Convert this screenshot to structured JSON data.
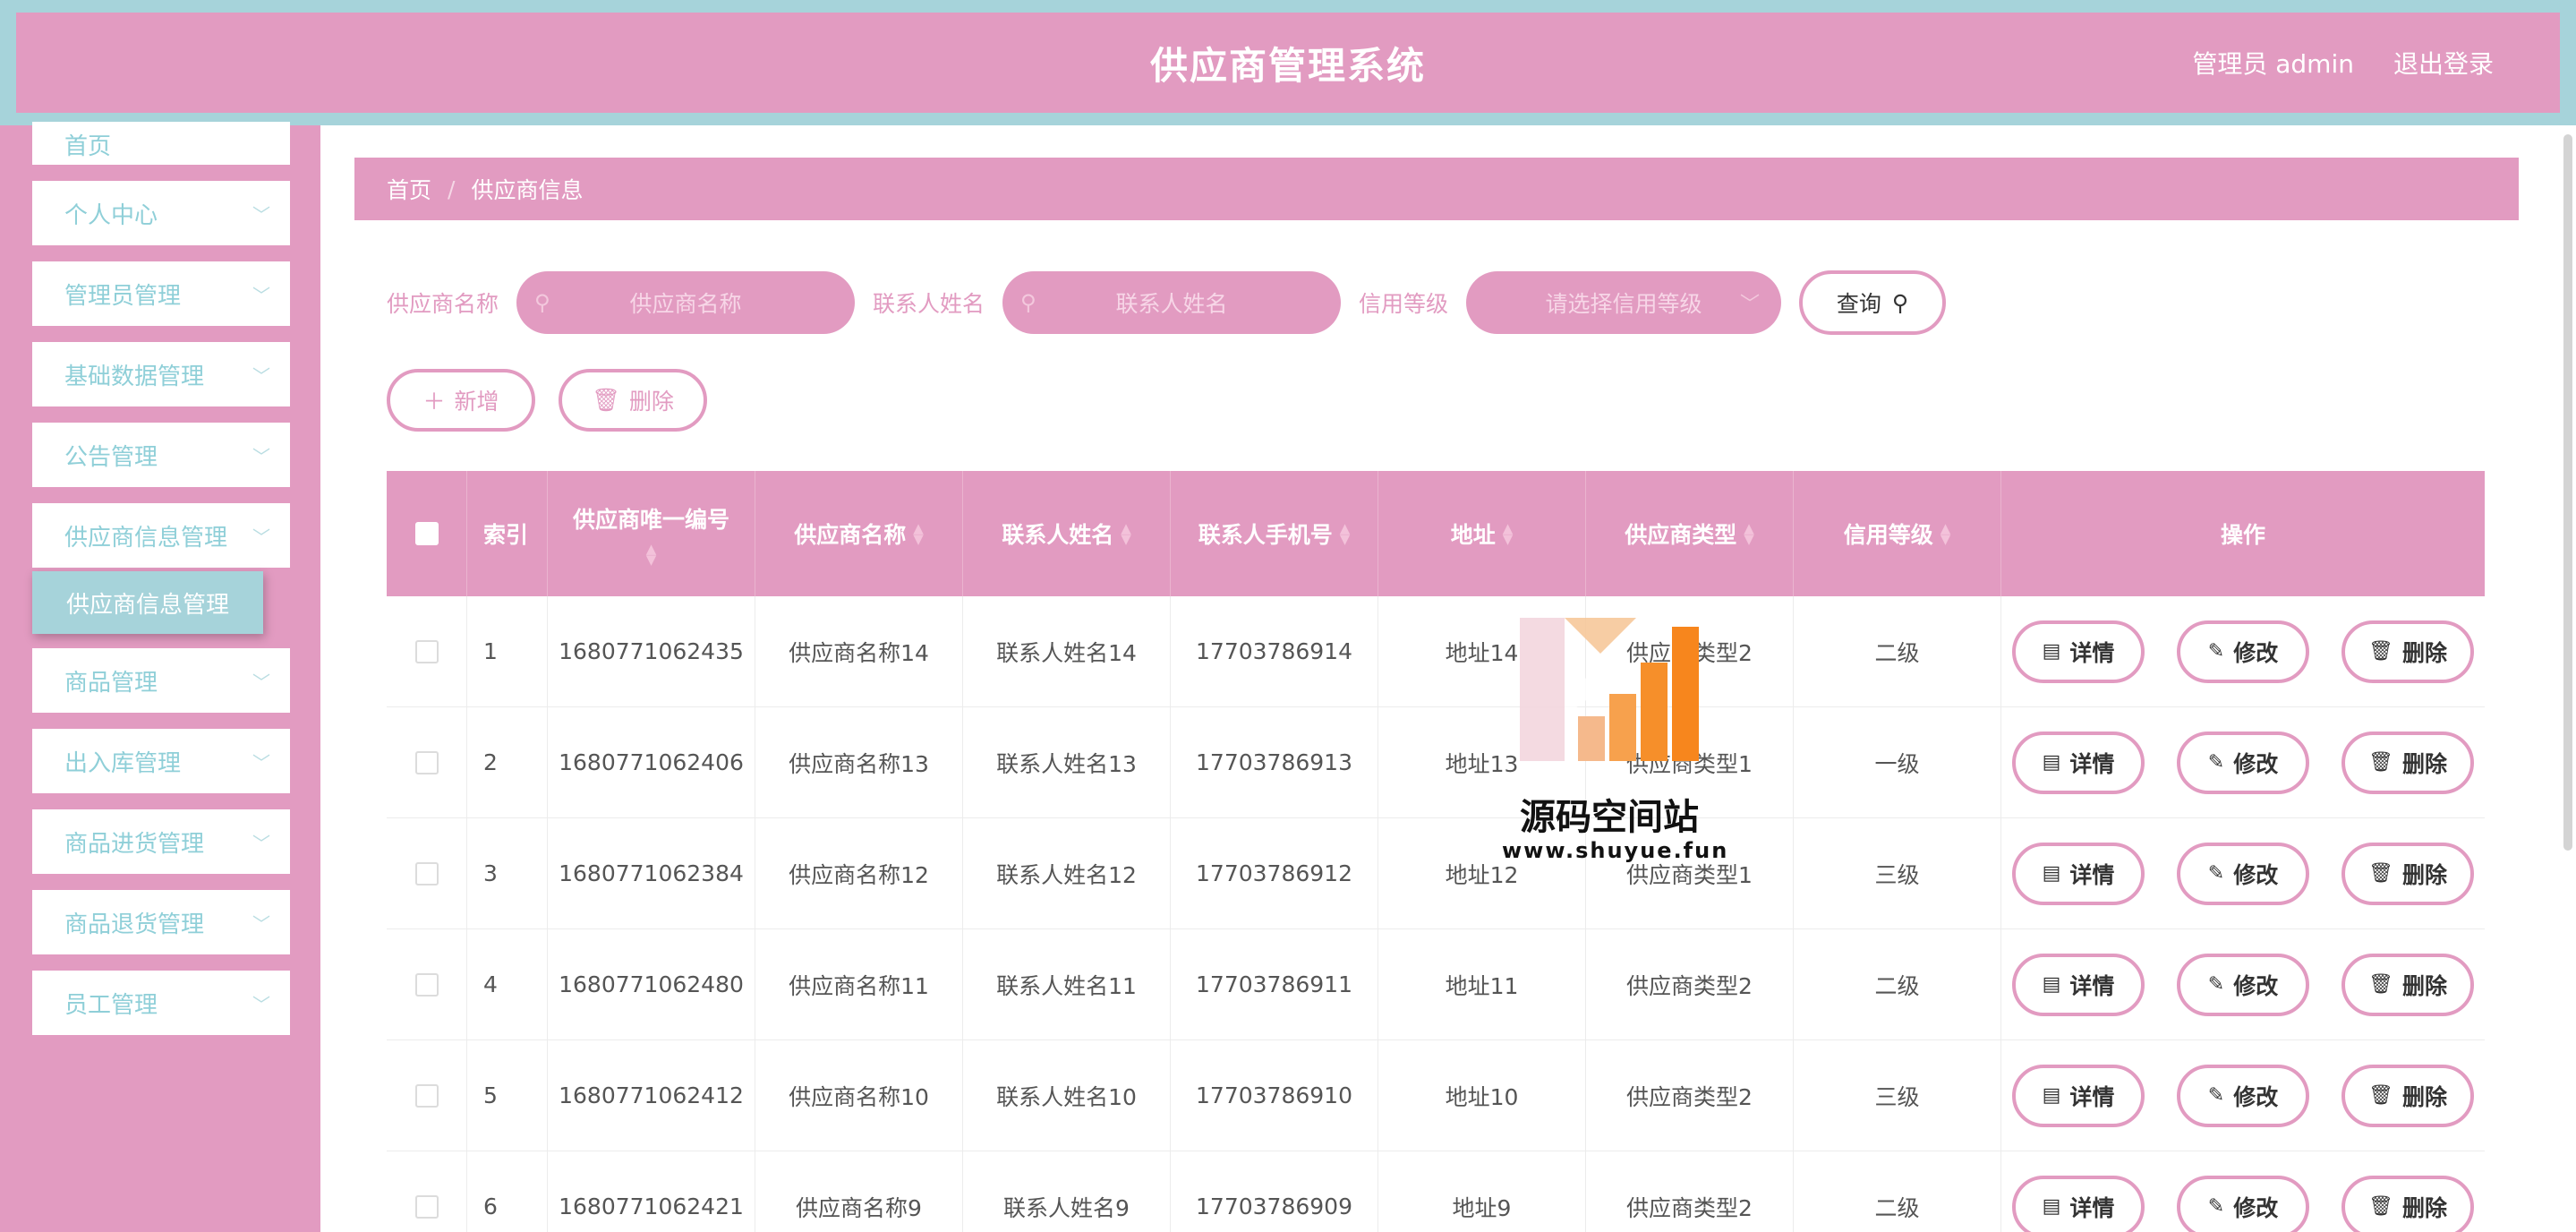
{
  "header": {
    "title": "供应商管理系统",
    "user_label": "管理员 admin",
    "logout_label": "退出登录"
  },
  "sidebar": {
    "items": [
      {
        "label": "首页"
      },
      {
        "label": "个人中心"
      },
      {
        "label": "管理员管理"
      },
      {
        "label": "基础数据管理"
      },
      {
        "label": "公告管理"
      },
      {
        "label": "供应商信息管理"
      },
      {
        "label": "商品管理"
      },
      {
        "label": "出入库管理"
      },
      {
        "label": "商品进货管理"
      },
      {
        "label": "商品退货管理"
      },
      {
        "label": "员工管理"
      }
    ],
    "active_sub": "供应商信息管理"
  },
  "breadcrumb": {
    "home": "首页",
    "separator": "/",
    "current": "供应商信息"
  },
  "search": {
    "supplier_name_label": "供应商名称",
    "supplier_name_placeholder": "供应商名称",
    "contact_name_label": "联系人姓名",
    "contact_name_placeholder": "联系人姓名",
    "credit_label": "信用等级",
    "credit_placeholder": "请选择信用等级",
    "query_label": "查询"
  },
  "actions": {
    "add_label": "新增",
    "delete_label": "删除"
  },
  "table": {
    "headers": {
      "index": "索引",
      "code": "供应商唯一编号",
      "name": "供应商名称",
      "contact": "联系人姓名",
      "phone": "联系人手机号",
      "address": "地址",
      "type": "供应商类型",
      "credit": "信用等级",
      "ops": "操作"
    },
    "op_labels": {
      "detail": "详情",
      "edit": "修改",
      "delete": "删除"
    },
    "rows": [
      {
        "index": "1",
        "code": "1680771062435",
        "name": "供应商名称14",
        "contact": "联系人姓名14",
        "phone": "17703786914",
        "address": "地址14",
        "type": "供应商类型2",
        "credit": "二级"
      },
      {
        "index": "2",
        "code": "1680771062406",
        "name": "供应商名称13",
        "contact": "联系人姓名13",
        "phone": "17703786913",
        "address": "地址13",
        "type": "供应商类型1",
        "credit": "一级"
      },
      {
        "index": "3",
        "code": "1680771062384",
        "name": "供应商名称12",
        "contact": "联系人姓名12",
        "phone": "17703786912",
        "address": "地址12",
        "type": "供应商类型1",
        "credit": "三级"
      },
      {
        "index": "4",
        "code": "1680771062480",
        "name": "供应商名称11",
        "contact": "联系人姓名11",
        "phone": "17703786911",
        "address": "地址11",
        "type": "供应商类型2",
        "credit": "二级"
      },
      {
        "index": "5",
        "code": "1680771062412",
        "name": "供应商名称10",
        "contact": "联系人姓名10",
        "phone": "17703786910",
        "address": "地址10",
        "type": "供应商类型2",
        "credit": "三级"
      },
      {
        "index": "6",
        "code": "1680771062421",
        "name": "供应商名称9",
        "contact": "联系人姓名9",
        "phone": "17703786909",
        "address": "地址9",
        "type": "供应商类型2",
        "credit": "二级"
      }
    ]
  },
  "watermark": {
    "title": "源码空间站",
    "url": "www.shuyue.fun"
  },
  "colors": {
    "primary_pink": "#e29bc1",
    "accent_teal": "#a6d3da"
  }
}
